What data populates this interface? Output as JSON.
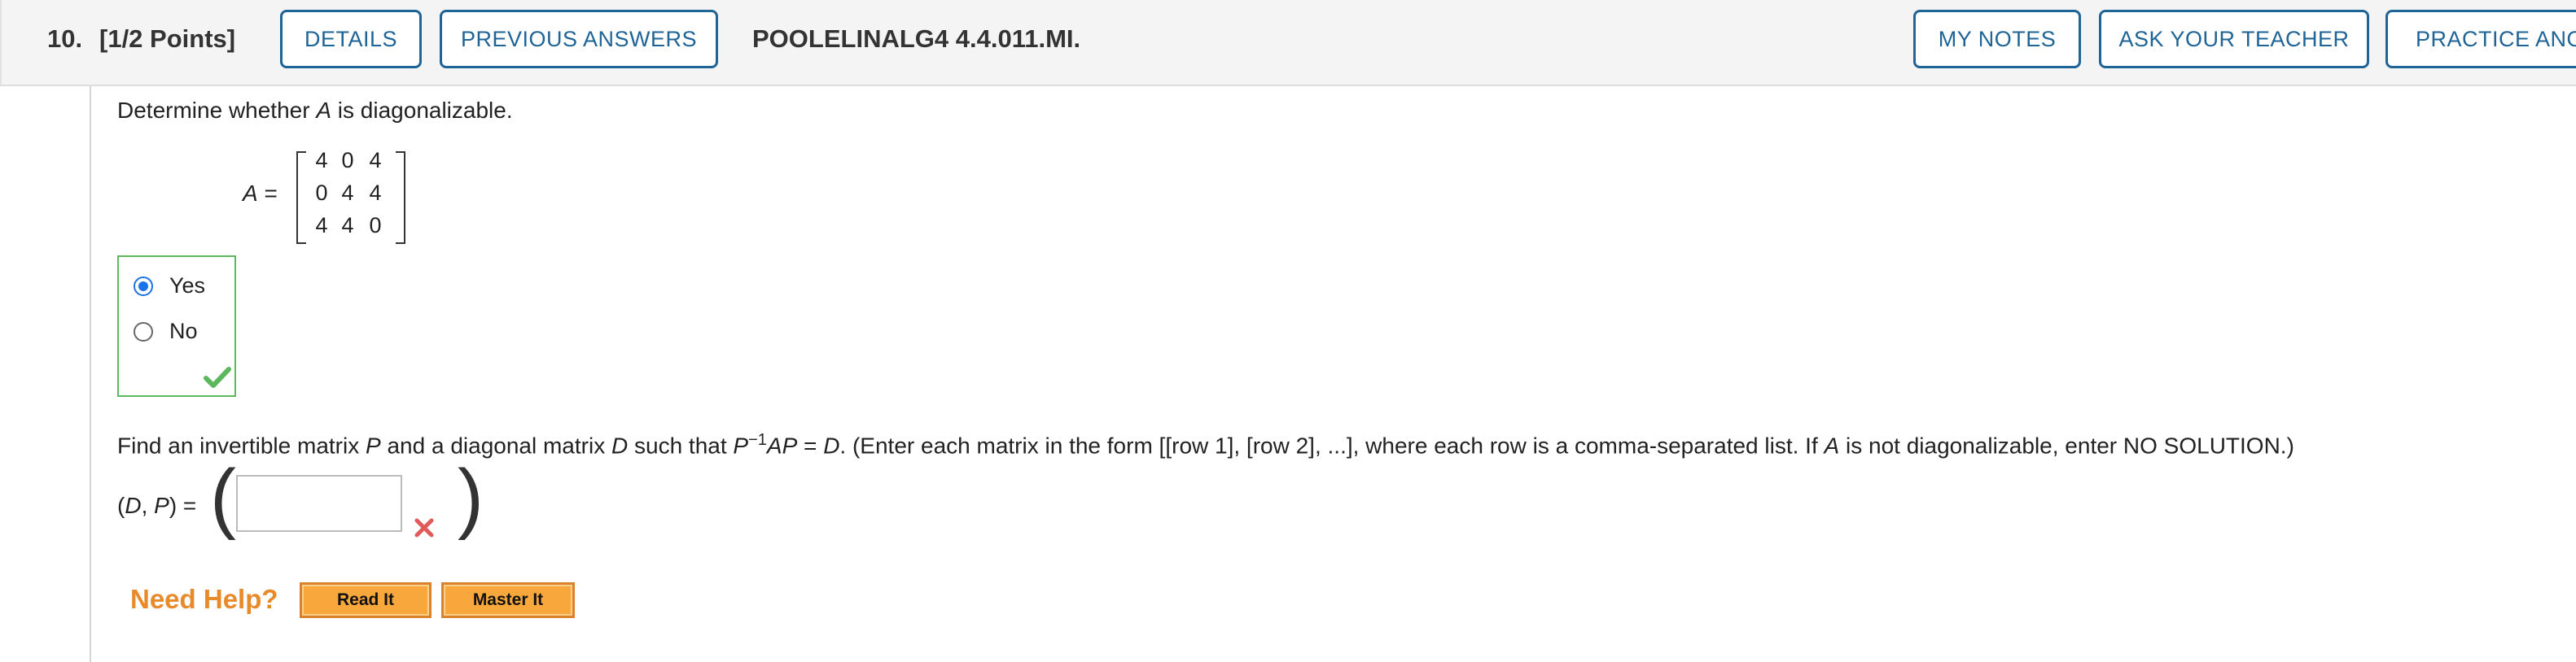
{
  "header": {
    "question_number": "10.",
    "points": "[1/2 Points]",
    "details_label": "DETAILS",
    "previous_answers_label": "PREVIOUS ANSWERS",
    "question_code": "POOLELINALG4 4.4.011.MI.",
    "my_notes_label": "MY NOTES",
    "ask_teacher_label": "ASK YOUR TEACHER",
    "practice_label": "PRACTICE ANO"
  },
  "part1": {
    "prompt_start": "Determine whether ",
    "prompt_var": "A",
    "prompt_end": " is diagonalizable.",
    "matrix_label": "A =",
    "matrix": [
      [
        "4",
        "0",
        "4"
      ],
      [
        "0",
        "4",
        "4"
      ],
      [
        "4",
        "4",
        "0"
      ]
    ],
    "options": [
      {
        "label": "Yes",
        "selected": true
      },
      {
        "label": "No",
        "selected": false
      }
    ],
    "status_icon": "check-icon"
  },
  "part2": {
    "prompt_1": "Find an invertible matrix ",
    "var_P": "P",
    "prompt_2": " and a diagonal matrix ",
    "var_D": "D",
    "prompt_3": " such that ",
    "formula_P": "P",
    "formula_exp": "−1",
    "formula_AP": "AP",
    "formula_eq": " = ",
    "formula_D": "D",
    "prompt_4": ". (Enter each matrix in the form [[row 1], [row 2], ...], where each row is a comma-separated list. If ",
    "var_A": "A",
    "prompt_5": " is not diagonalizable, enter NO SOLUTION.)",
    "answer_label": "(D, P) =",
    "answer_value": "",
    "status_icon": "x-icon"
  },
  "help": {
    "label": "Need Help?",
    "read_it": "Read It",
    "master_it": "Master It"
  },
  "colors": {
    "accent_blue": "#1f6496",
    "correct_green": "#5cb85c",
    "incorrect_red": "#e05a5a",
    "help_orange": "#e8892a"
  }
}
